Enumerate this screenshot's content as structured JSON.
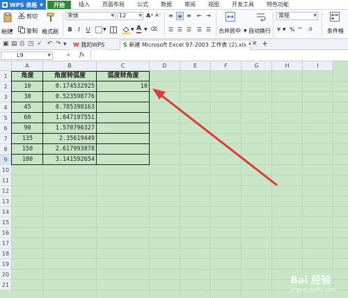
{
  "app": {
    "title": "WPS 表格"
  },
  "menu": [
    "开始",
    "插入",
    "页面布局",
    "公式",
    "数据",
    "审阅",
    "视图",
    "开发工具",
    "特色功能"
  ],
  "ribbon": {
    "paste": "粘贴",
    "cut": "剪切",
    "copy": "复制",
    "format_painter": "格式刷",
    "font_name": "宋体",
    "font_size": "12",
    "bold": "B",
    "italic": "I",
    "underline": "U",
    "merge_center": "合并居中",
    "wrap_text": "自动换行",
    "number_format": "常规",
    "currency": "¥",
    "percent": "%",
    "conditional": "条件格",
    "font_color": "#d93a2f",
    "fill_color": "#f5d42a"
  },
  "tabs": {
    "my_wps": "我的WPS",
    "document": "新建 Microsoft Excel 97-2003 工作表 (2).xls *",
    "add": "+"
  },
  "formula_bar": {
    "name_box": "L9",
    "fx": "fx"
  },
  "columns": [
    "A",
    "B",
    "C",
    "D",
    "E",
    "F",
    "G",
    "H",
    "I"
  ],
  "rows": [
    "1",
    "2",
    "3",
    "4",
    "5",
    "6",
    "7",
    "8",
    "9",
    "10",
    "11",
    "12",
    "13",
    "14",
    "15",
    "16",
    "17",
    "18",
    "19",
    "20",
    "21"
  ],
  "table": {
    "headers": [
      "角度",
      "角度转弧度",
      "弧度转角度"
    ],
    "rows": [
      [
        "10",
        "0.174532925",
        "10"
      ],
      [
        "30",
        "0.523598776",
        ""
      ],
      [
        "45",
        "0.785398163",
        ""
      ],
      [
        "60",
        "1.047197551",
        ""
      ],
      [
        "90",
        "1.570796327",
        ""
      ],
      [
        "135",
        "2.35619449",
        ""
      ],
      [
        "150",
        "2.617993878",
        ""
      ],
      [
        "180",
        "3.141592654",
        ""
      ]
    ]
  },
  "watermark": {
    "brand": "Bai 经验",
    "url": "jingyan.baidu.com"
  },
  "colors": {
    "grid_bg": "#c7e6c6",
    "arrow": "#e03a35",
    "accent": "#2a7bd0",
    "active_menu": "#2f8b2f"
  }
}
